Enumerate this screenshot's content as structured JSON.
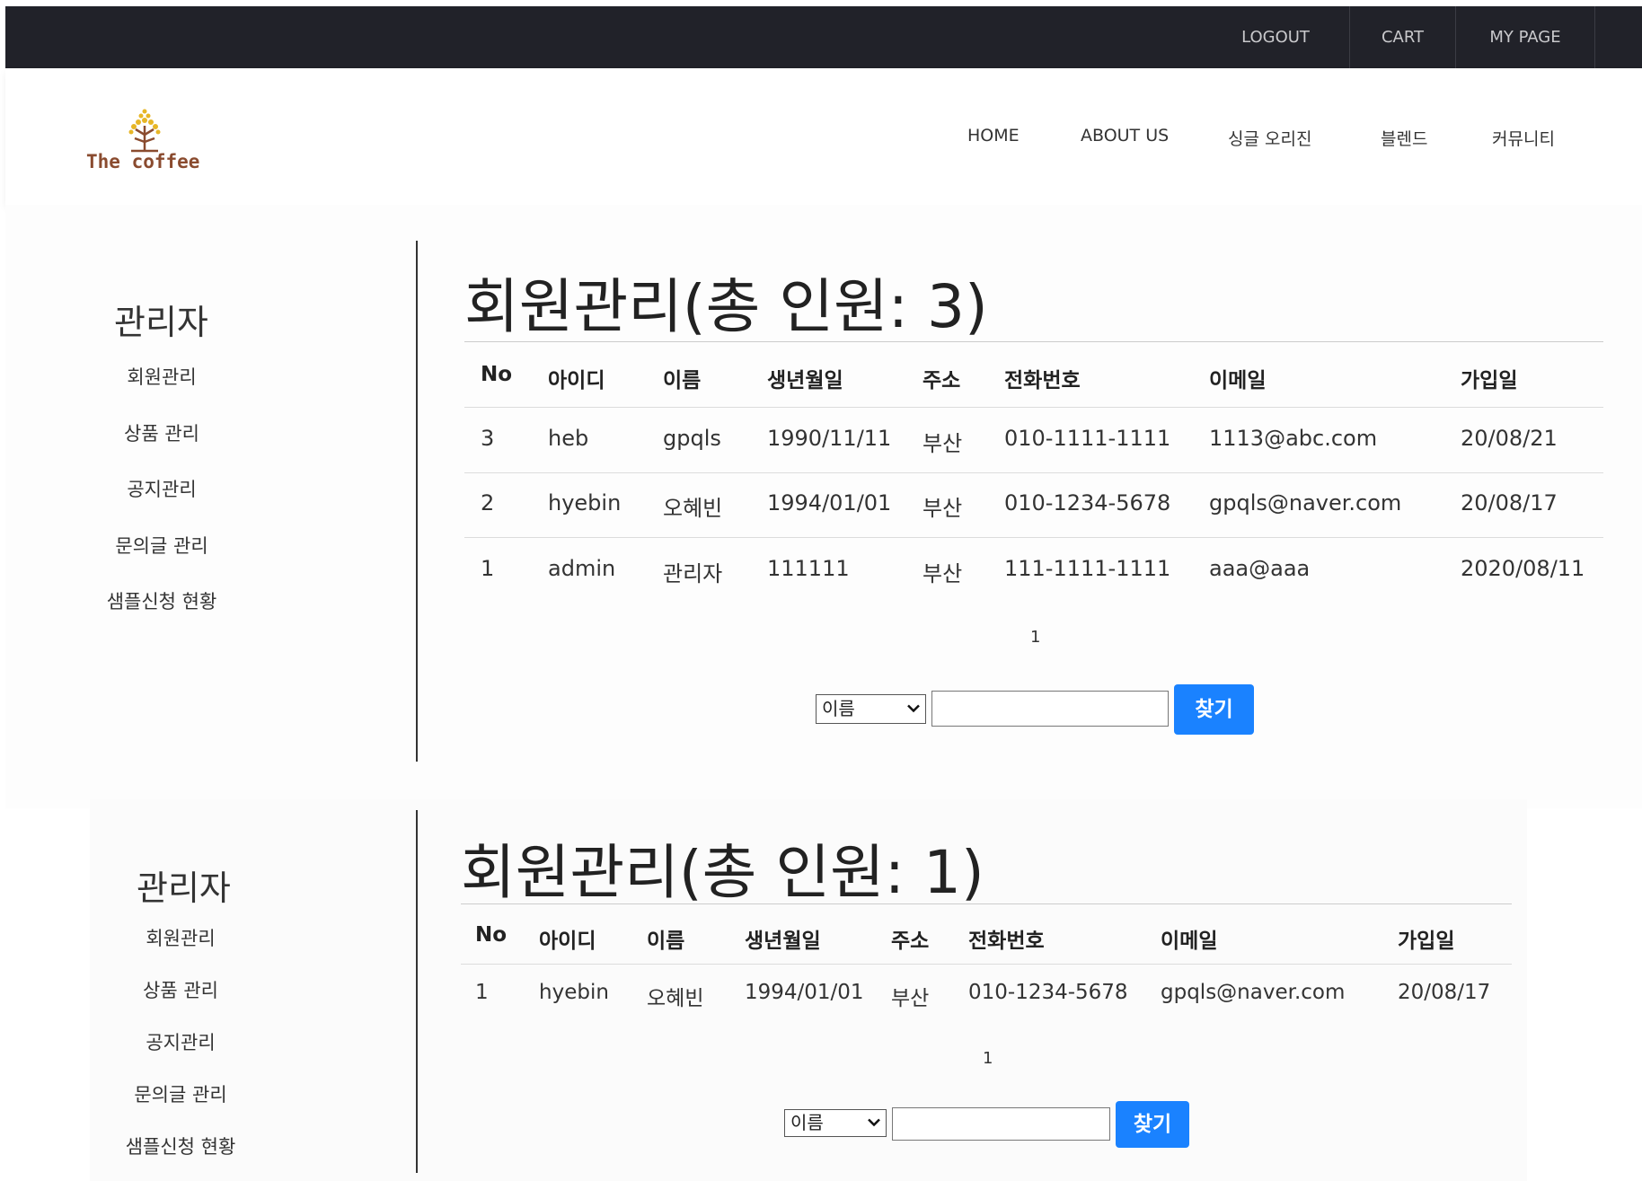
{
  "topbar": {
    "links": [
      {
        "label": "LOGOUT"
      },
      {
        "label": "CART"
      },
      {
        "label": "MY PAGE"
      }
    ]
  },
  "header": {
    "logo_text": "The coffee",
    "nav": [
      {
        "label": "HOME"
      },
      {
        "label": "ABOUT US"
      },
      {
        "label": "싱글 오리진"
      },
      {
        "label": "블렌드"
      },
      {
        "label": "커뮤니티"
      }
    ]
  },
  "panels": [
    {
      "sidebar": {
        "title": "관리자",
        "items": [
          "회원관리",
          "상품 관리",
          "공지관리",
          "문의글 관리",
          "샘플신청 현황"
        ]
      },
      "title": "회원관리(총 인원: 3)",
      "table": {
        "columns": [
          "No",
          "아이디",
          "이름",
          "생년월일",
          "주소",
          "전화번호",
          "이메일",
          "가입일"
        ],
        "rows": [
          [
            "3",
            "heb",
            "gpqls",
            "1990/11/11",
            "부산",
            "010-1111-1111",
            "1113@abc.com",
            "20/08/21"
          ],
          [
            "2",
            "hyebin",
            "오혜빈",
            "1994/01/01",
            "부산",
            "010-1234-5678",
            "gpqls@naver.com",
            "20/08/17"
          ],
          [
            "1",
            "admin",
            "관리자",
            "111111",
            "부산",
            "111-1111-1111",
            "aaa@aaa",
            "2020/08/11"
          ]
        ]
      },
      "pager": "1",
      "search": {
        "select_value": "이름",
        "input_value": "",
        "button_label": "찾기"
      }
    },
    {
      "sidebar": {
        "title": "관리자",
        "items": [
          "회원관리",
          "상품 관리",
          "공지관리",
          "문의글 관리",
          "샘플신청 현황"
        ]
      },
      "title": "회원관리(총 인원: 1)",
      "table": {
        "columns": [
          "No",
          "아이디",
          "이름",
          "생년월일",
          "주소",
          "전화번호",
          "이메일",
          "가입일"
        ],
        "rows": [
          [
            "1",
            "hyebin",
            "오혜빈",
            "1994/01/01",
            "부산",
            "010-1234-5678",
            "gpqls@naver.com",
            "20/08/17"
          ]
        ]
      },
      "pager": "1",
      "search": {
        "select_value": "이름",
        "input_value": "",
        "button_label": "찾기"
      }
    }
  ],
  "colors": {
    "topbar": "#212229",
    "button": "#1a82ff",
    "logo_text": "#8a4b2f"
  },
  "icons": {
    "logo": "coffee-tree-logo-icon",
    "dropdown": "chevron-down-icon"
  }
}
